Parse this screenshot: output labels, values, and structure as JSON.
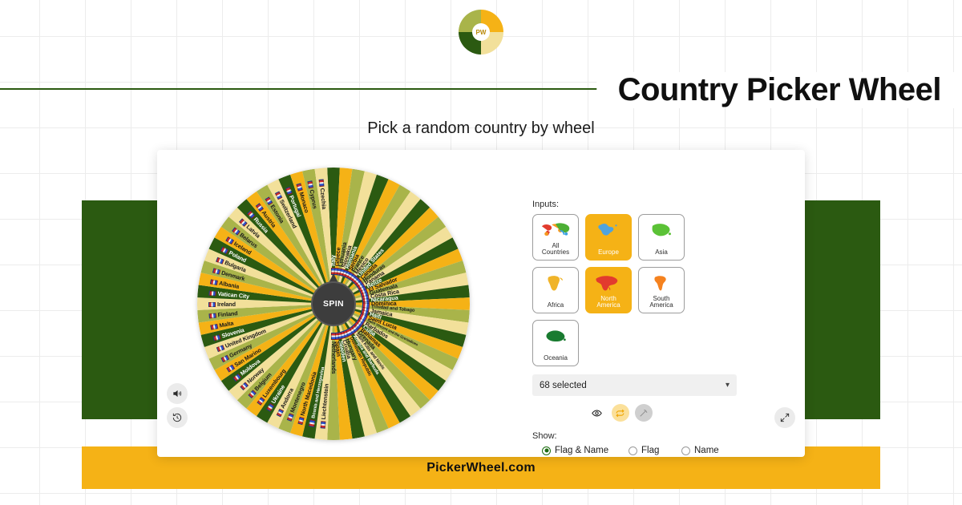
{
  "header": {
    "logo_text": "PW",
    "title": "Country Picker Wheel",
    "subtitle": "Pick a random country by wheel"
  },
  "footer": {
    "text": "PickerWheel.com"
  },
  "wheel": {
    "spin_label": "SPIN",
    "segment_colors": [
      "#2b5a11",
      "#f5b216",
      "#a9b44a",
      "#f2e09a"
    ],
    "segments": [
      "Italy",
      "Greece",
      "Lithuania",
      "Slovakia",
      "Romania",
      "Serbia",
      "France",
      "Mexico",
      "United States",
      "Canada",
      "Honduras",
      "Panama",
      "Belize",
      "El Salvador",
      "Guatemala",
      "Costa Rica",
      "Nicaragua",
      "Dominica",
      "Trinidad and Tobago",
      "Jamaica",
      "Haiti",
      "Saint Lucia",
      "Saint Vincent and the Grenadines",
      "Barbados",
      "Cuba",
      "Bahamas",
      "Grenada",
      "Saint Kitts and Nevis",
      "Antigua and Barbuda",
      "Dominican Republic",
      "Hungary",
      "Croatia",
      "Sweden",
      "Spain",
      "Netherlands",
      "Liechtenstein",
      "Bosnia and Herzegovina",
      "North Macedonia",
      "Montenegro",
      "Andorra",
      "Ukraine",
      "Luxembourg",
      "Belgium",
      "Norway",
      "Moldova",
      "San Marino",
      "Germany",
      "United Kingdom",
      "Slovenia",
      "Malta",
      "Finland",
      "Ireland",
      "Vatican City",
      "Albania",
      "Denmark",
      "Bulgaria",
      "Poland",
      "Iceland",
      "Belarus",
      "Latvia",
      "Russia",
      "Austria",
      "Estonia",
      "Switzerland",
      "Portugal",
      "Monaco",
      "Cyprus",
      "Czechia"
    ]
  },
  "controls": {
    "sound_icon": "speaker-icon",
    "history_icon": "history-icon",
    "fullscreen_icon": "expand-icon"
  },
  "panel": {
    "inputs_label": "Inputs:",
    "tiles": [
      {
        "name": "All\nCountries",
        "label_line1": "All",
        "label_line2": "Countries",
        "active": false,
        "icon": "world-map-icon"
      },
      {
        "name": "Europe",
        "label_line1": "Europe",
        "label_line2": "",
        "active": true,
        "icon": "europe-map-icon"
      },
      {
        "name": "Asia",
        "label_line1": "Asia",
        "label_line2": "",
        "active": false,
        "icon": "asia-map-icon"
      },
      {
        "name": "Africa",
        "label_line1": "Africa",
        "label_line2": "",
        "active": false,
        "icon": "africa-map-icon"
      },
      {
        "name": "North America",
        "label_line1": "North",
        "label_line2": "America",
        "active": true,
        "icon": "north-america-map-icon"
      },
      {
        "name": "South America",
        "label_line1": "South",
        "label_line2": "America",
        "active": false,
        "icon": "south-america-map-icon"
      },
      {
        "name": "Oceania",
        "label_line1": "Oceania",
        "label_line2": "",
        "active": false,
        "icon": "oceania-map-icon"
      }
    ],
    "select_value": "68 selected",
    "select_chevron": "chevron-down-icon",
    "mid_icons": [
      {
        "name": "eye-icon",
        "style": "plain"
      },
      {
        "name": "shuffle-icon",
        "style": "gold"
      },
      {
        "name": "magic-wand-icon",
        "style": "grey"
      }
    ],
    "show_label": "Show:",
    "show_options": [
      {
        "label": "Flag & Name",
        "selected": true
      },
      {
        "label": "Flag",
        "selected": false
      },
      {
        "label": "Name",
        "selected": false
      }
    ]
  },
  "colors": {
    "dark_green": "#2b5a11",
    "gold": "#f5b216",
    "olive": "#a9b44a",
    "cream": "#f2e09a"
  }
}
